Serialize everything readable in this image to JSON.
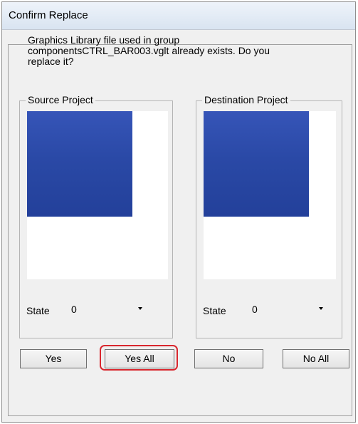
{
  "window": {
    "title": "Confirm Replace"
  },
  "message": "Graphics Library file used in group\ncomponentsCTRL_BAR003.vglt already exists. Do you\nreplace it?",
  "source": {
    "legend": "Source Project",
    "state_label": "State",
    "state_value": "0",
    "preview_color": "#2d4cab"
  },
  "destination": {
    "legend": "Destination Project",
    "state_label": "State",
    "state_value": "0",
    "preview_color": "#2d4cab"
  },
  "buttons": {
    "yes": "Yes",
    "yes_all": "Yes All",
    "no": "No",
    "no_all": "No All"
  },
  "colors": {
    "highlight": "#d9272e"
  }
}
